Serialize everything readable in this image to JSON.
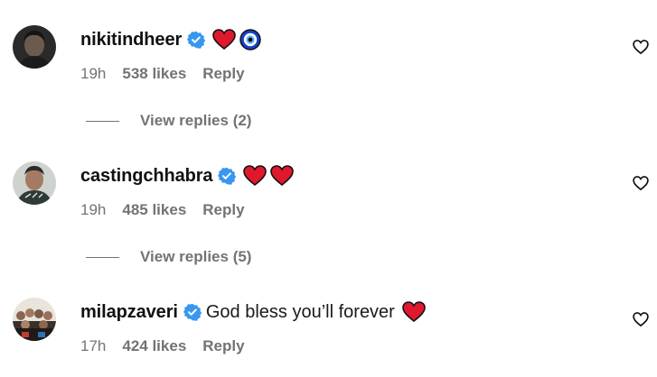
{
  "comments": [
    {
      "username": "nikitindheer",
      "text": "",
      "emojis": [
        "red-heart",
        "nazar-amulet"
      ],
      "time": "19h",
      "likes": "538 likes",
      "reply": "Reply",
      "view_replies": "View replies (2)"
    },
    {
      "username": "castingchhabra",
      "text": "",
      "emojis": [
        "red-heart",
        "red-heart"
      ],
      "time": "19h",
      "likes": "485 likes",
      "reply": "Reply",
      "view_replies": "View replies (5)"
    },
    {
      "username": "milapzaveri",
      "text": "God bless you’ll forever",
      "emojis": [
        "red-heart"
      ],
      "time": "17h",
      "likes": "424 likes",
      "reply": "Reply"
    }
  ],
  "colors": {
    "verified_badge": "#3897f0",
    "secondary_text": "#737373",
    "heart_emoji": "#e0182d",
    "nazar_blue": "#1540c8"
  }
}
